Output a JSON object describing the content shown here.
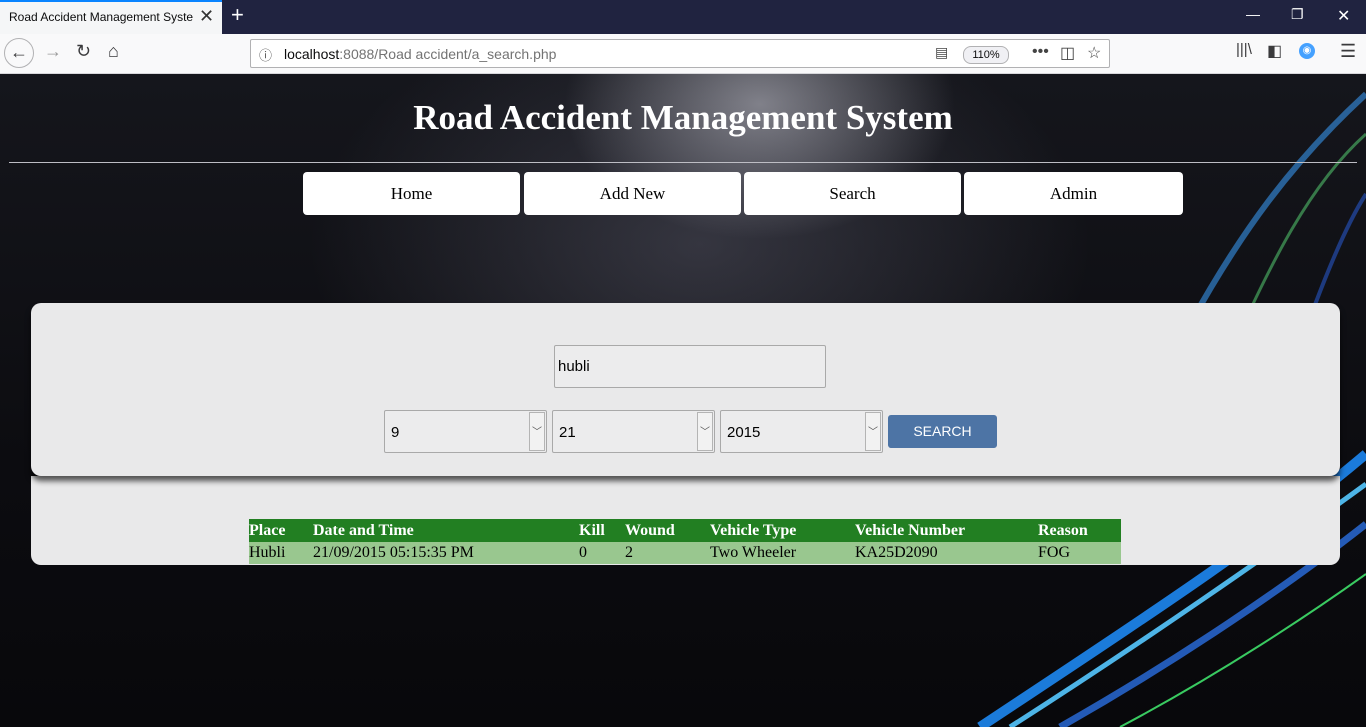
{
  "browser": {
    "tab_title": "Road Accident Management System",
    "url_host": "localhost",
    "url_rest": ":8088/Road accident/a_search.php",
    "zoom": "110%"
  },
  "site": {
    "title": "Road Accident Management System",
    "menu": [
      "Home",
      "Add New",
      "Search",
      "Admin"
    ]
  },
  "search_form": {
    "place_value": "hubli",
    "month_value": "9",
    "day_value": "21",
    "year_value": "2015",
    "search_label": "SEARCH"
  },
  "results": {
    "headers": [
      "Place",
      "Date and Time",
      "Kill",
      "Wound",
      "Vehicle Type",
      "Vehicle Number",
      "Reason"
    ],
    "rows": [
      [
        "Hubli",
        "21/09/2015 05:15:35 PM",
        "0",
        "2",
        "Two Wheeler",
        "KA25D2090",
        "FOG"
      ]
    ]
  },
  "colors": {
    "header_green": "#227f22",
    "row_green": "#99c78f",
    "search_blue": "#4d74a5"
  }
}
